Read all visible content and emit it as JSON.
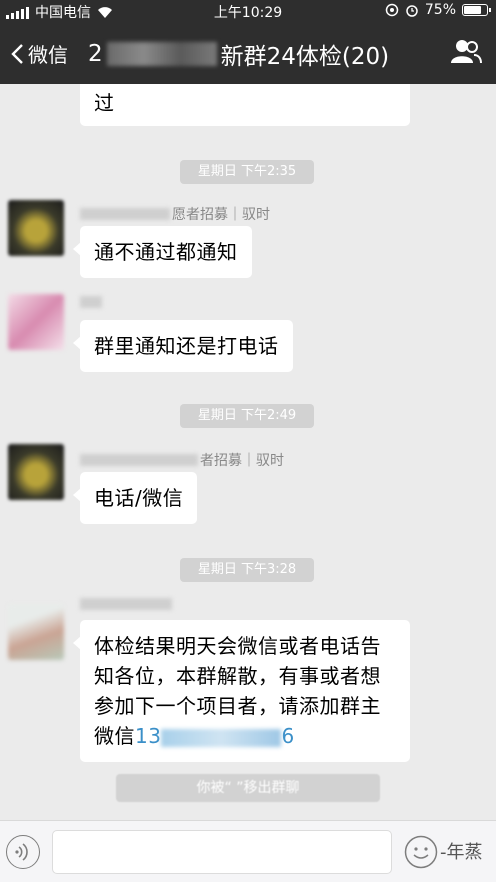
{
  "status_bar": {
    "carrier": "中国电信",
    "time": "上午10:29",
    "battery": "75%",
    "battery_level": 0.75
  },
  "nav": {
    "back_label": "微信",
    "title_prefix": "2",
    "title_suffix": "新群24体检(20)"
  },
  "messages": [
    {
      "text": "过"
    },
    {
      "text": "通不通过都通知",
      "sender": "愿者招募｜驭时"
    },
    {
      "text": "群里通知还是打电话"
    },
    {
      "text": "电话/微信",
      "sender": "者招募｜驭时"
    },
    {
      "lines": [
        "体检结果明天会微信或者电话告",
        "知各位，本群解散，有事或者想",
        "参加下一个项目者，请添加群主"
      ],
      "last_line_prefix": "微信",
      "phone_visible": "13",
      "phone_tail": "6"
    }
  ],
  "time_pills": [
    "星期日 下午2:35",
    "星期日 下午2:49",
    "星期日 下午3:28"
  ],
  "system_notice": "你被“      ”移出群聊",
  "input_bar": {
    "watermark": "-年蒸"
  }
}
